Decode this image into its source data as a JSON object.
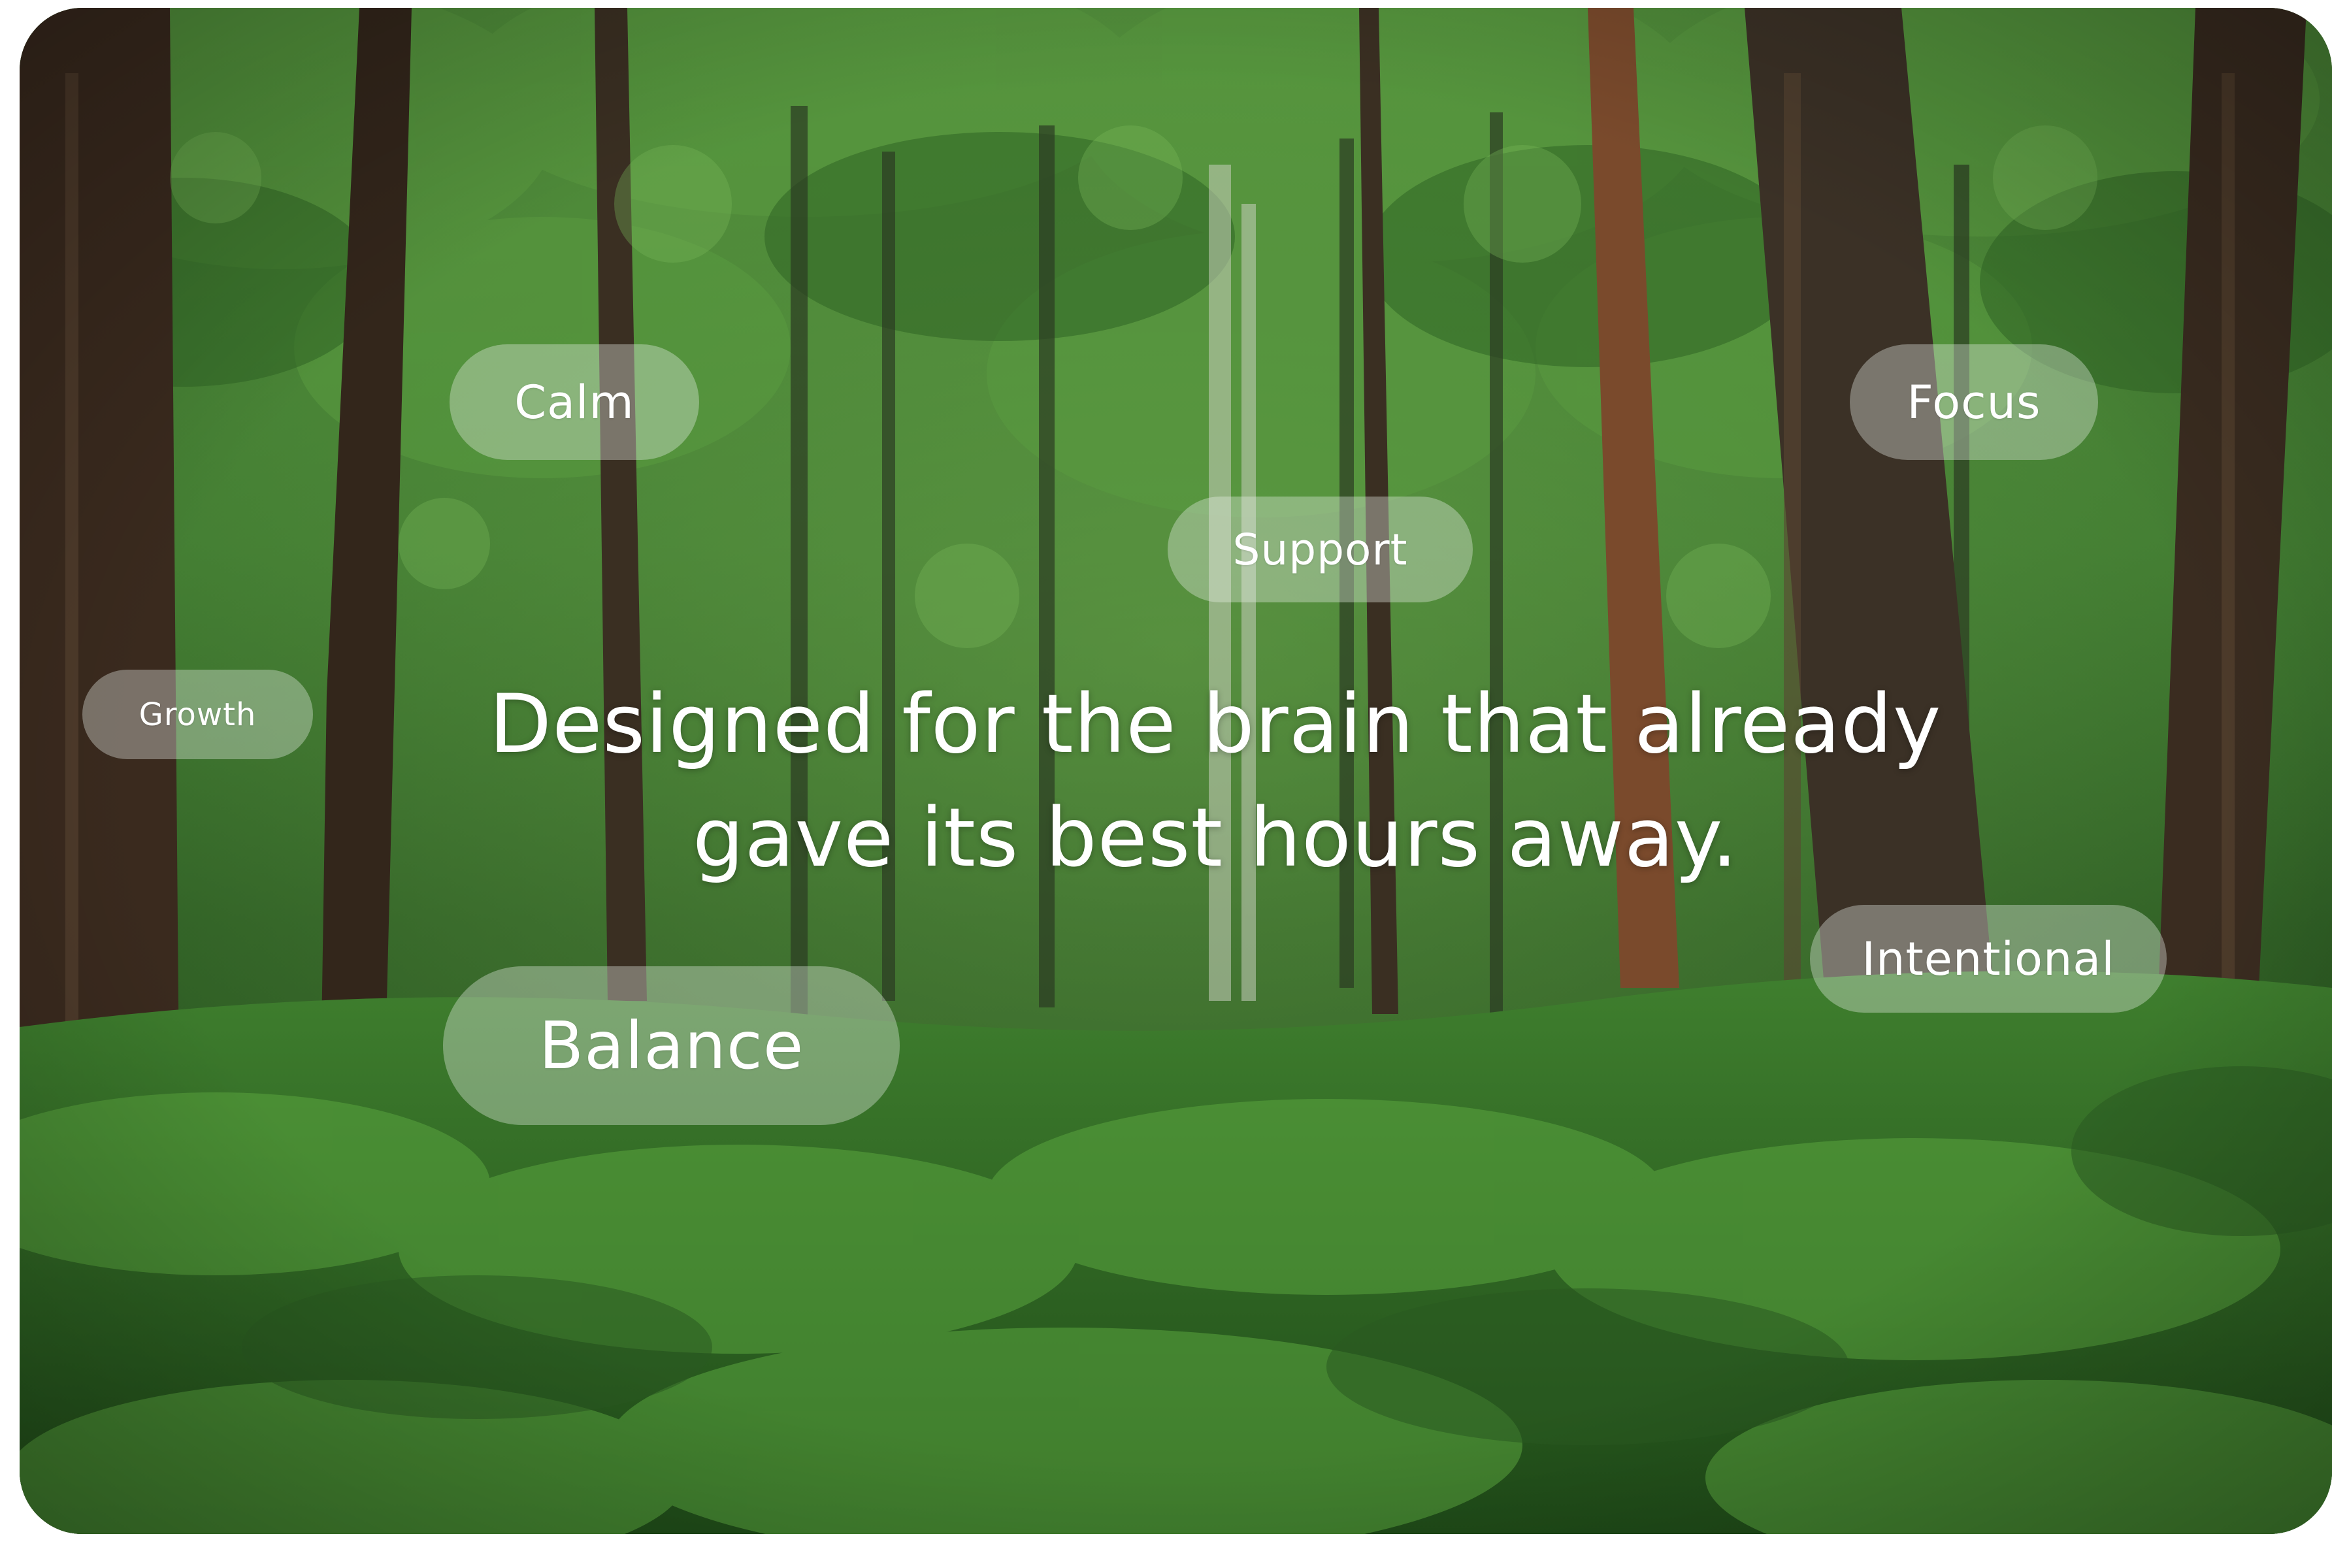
{
  "hero": {
    "headline_line1": "Designed for the brain that already",
    "headline_line2": "gave its best hours away."
  },
  "tags": {
    "calm": "Calm",
    "focus": "Focus",
    "support": "Support",
    "growth": "Growth",
    "intentional": "Intentional",
    "balance": "Balance"
  },
  "colors": {
    "text": "#ffffff",
    "pill_fill": "#ecf0ec",
    "forest_canopy": "#3f7a30",
    "forest_floor": "#2f6a24",
    "bark": "#3a2a1e"
  }
}
